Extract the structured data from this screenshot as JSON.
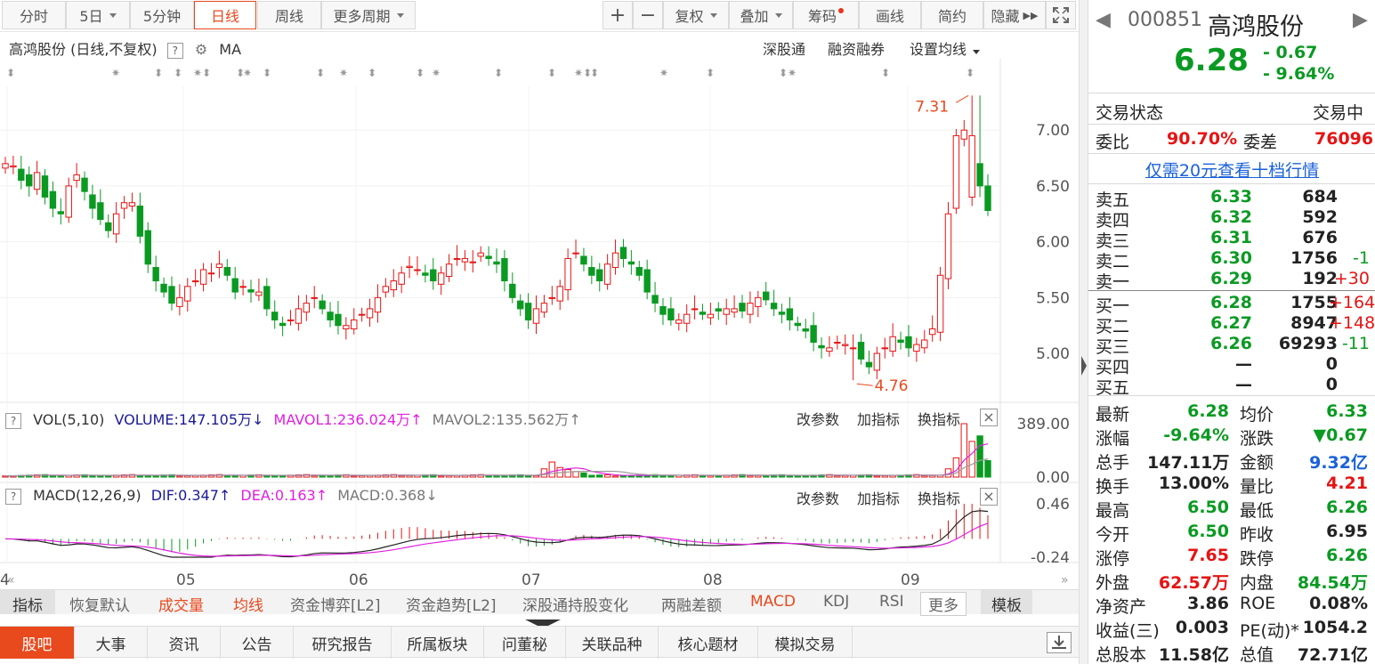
{
  "toolbar": {
    "periods": [
      "分时",
      "5日",
      "5分钟",
      "日线",
      "周线",
      "更多周期"
    ],
    "tools": [
      "复权",
      "叠加",
      "筹码",
      "画线",
      "简约",
      "隐藏"
    ],
    "plus": "+",
    "minus": "−"
  },
  "main_header": {
    "title": "高鸿股份 (日线,不复权)",
    "help": "?",
    "indicator": "MA",
    "links": [
      "深股通",
      "融资融券",
      "设置均线"
    ]
  },
  "vol_header": {
    "help": "?",
    "name": "VOL(5,10)",
    "volume": "VOLUME:147.105万",
    "mavol1": "MAVOL1:236.024万",
    "mavol2": "MAVOL2:135.562万",
    "actions": [
      "改参数",
      "加指标",
      "换指标"
    ],
    "close": "×"
  },
  "macd_header": {
    "help": "?",
    "name": "MACD(12,26,9)",
    "dif": "DIF:0.347",
    "dea": "DEA:0.163",
    "macd": "MACD:0.368",
    "actions": [
      "改参数",
      "加指标",
      "换指标"
    ],
    "close": "×"
  },
  "colors": {
    "up": "#e61414",
    "down": "#0a9a22",
    "accent": "#e8491d",
    "ma_dif": "#222222",
    "dea": "#e020e0"
  },
  "chart_data": [
    {
      "type": "candlestick",
      "title": "高鸿股份 (日线,不复权)",
      "x_ticks": [
        "4",
        "05",
        "06",
        "07",
        "08",
        "09"
      ],
      "y_ticks": [
        7.0,
        6.5,
        6.0,
        5.5,
        5.0
      ],
      "ylim": [
        4.65,
        7.4
      ],
      "annotations": [
        {
          "label": "7.31",
          "value": 7.31
        },
        {
          "label": "4.76",
          "value": 4.76
        }
      ],
      "closes": [
        6.7,
        6.68,
        6.55,
        6.5,
        6.62,
        6.4,
        6.3,
        6.25,
        6.5,
        6.6,
        6.45,
        6.3,
        6.2,
        6.1,
        6.25,
        6.35,
        6.35,
        6.05,
        5.8,
        5.65,
        5.55,
        5.45,
        5.5,
        5.6,
        5.65,
        5.75,
        5.72,
        5.8,
        5.7,
        5.55,
        5.6,
        5.55,
        5.55,
        5.4,
        5.3,
        5.25,
        5.3,
        5.4,
        5.45,
        5.5,
        5.4,
        5.3,
        5.25,
        5.25,
        5.3,
        5.35,
        5.4,
        5.5,
        5.6,
        5.65,
        5.72,
        5.78,
        5.75,
        5.7,
        5.65,
        5.72,
        5.8,
        5.85,
        5.85,
        5.82,
        5.9,
        5.85,
        5.8,
        5.65,
        5.5,
        5.4,
        5.3,
        5.4,
        5.45,
        5.5,
        5.6,
        5.85,
        5.9,
        5.8,
        5.7,
        5.65,
        5.8,
        5.9,
        5.85,
        5.8,
        5.7,
        5.55,
        5.45,
        5.35,
        5.3,
        5.3,
        5.35,
        5.4,
        5.35,
        5.35,
        5.38,
        5.4,
        5.4,
        5.38,
        5.45,
        5.5,
        5.48,
        5.4,
        5.35,
        5.3,
        5.25,
        5.2,
        5.1,
        5.05,
        5.05,
        5.1,
        5.08,
        5.05,
        4.95,
        4.88,
        5.0,
        5.05,
        5.15,
        5.1,
        5.05,
        5.08,
        5.12,
        5.22,
        5.7,
        6.25,
        6.95,
        7.0,
        6.95,
        6.5,
        6.28
      ],
      "volume_ylim": [
        0,
        389.0
      ],
      "volume_ticks": [
        389.0,
        0.0
      ],
      "macd_ylim": [
        -0.24,
        0.46
      ],
      "macd_ticks": [
        0.46,
        -0.24
      ]
    }
  ],
  "bottom": {
    "indicator_tabs": [
      "指标",
      "恢复默认",
      "成交量",
      "均线",
      "资金博弈[L2]",
      "资金趋势[L2]",
      "深股通持股变化",
      "两融差额",
      "MACD",
      "KDJ",
      "RSI",
      "更多",
      "模板"
    ],
    "tabs": [
      "股吧",
      "大事",
      "资讯",
      "公告",
      "研究报告",
      "所属板块",
      "问董秘",
      "关联品种",
      "核心题材",
      "模拟交易"
    ]
  },
  "stock": {
    "code": "000851",
    "name": "高鸿股份",
    "price": "6.28",
    "change": "- 0.67",
    "change_pct": "- 9.64%"
  },
  "trade_status": {
    "label": "交易状态",
    "value": "交易中",
    "ratio_label": "委比",
    "ratio": "90.70%",
    "diff_label": "委差",
    "diff": "76096",
    "promo": "仅需20元查看十档行情"
  },
  "asks": [
    {
      "label": "卖五",
      "price": "6.33",
      "vol": "684",
      "chg": ""
    },
    {
      "label": "卖四",
      "price": "6.32",
      "vol": "592",
      "chg": ""
    },
    {
      "label": "卖三",
      "price": "6.31",
      "vol": "676",
      "chg": ""
    },
    {
      "label": "卖二",
      "price": "6.30",
      "vol": "1756",
      "chg": "-1"
    },
    {
      "label": "卖一",
      "price": "6.29",
      "vol": "192",
      "chg": "+30"
    }
  ],
  "bids": [
    {
      "label": "买一",
      "price": "6.28",
      "vol": "1755",
      "chg": "+164"
    },
    {
      "label": "买二",
      "price": "6.27",
      "vol": "8947",
      "chg": "+148"
    },
    {
      "label": "买三",
      "price": "6.26",
      "vol": "69293",
      "chg": "-11"
    },
    {
      "label": "买四",
      "price": "—",
      "vol": "0",
      "chg": ""
    },
    {
      "label": "买五",
      "price": "—",
      "vol": "0",
      "chg": ""
    }
  ],
  "stats": [
    {
      "l1": "最新",
      "v1": "6.28",
      "c1": "dn",
      "l2": "均价",
      "v2": "6.33",
      "c2": "dn"
    },
    {
      "l1": "涨幅",
      "v1": "-9.64%",
      "c1": "dn",
      "l2": "涨跌",
      "v2": "▼0.67",
      "c2": "dn"
    },
    {
      "l1": "总手",
      "v1": "147.11万",
      "c1": "blk",
      "l2": "金额",
      "v2": "9.32亿",
      "c2": "blu"
    },
    {
      "l1": "换手",
      "v1": "13.00%",
      "c1": "blk",
      "l2": "量比",
      "v2": "4.21",
      "c2": "up"
    },
    {
      "l1": "最高",
      "v1": "6.50",
      "c1": "dn",
      "l2": "最低",
      "v2": "6.26",
      "c2": "dn"
    },
    {
      "l1": "今开",
      "v1": "6.50",
      "c1": "dn",
      "l2": "昨收",
      "v2": "6.95",
      "c2": "blk"
    },
    {
      "l1": "涨停",
      "v1": "7.65",
      "c1": "up",
      "l2": "跌停",
      "v2": "6.26",
      "c2": "dn"
    },
    {
      "l1": "外盘",
      "v1": "62.57万",
      "c1": "up",
      "l2": "内盘",
      "v2": "84.54万",
      "c2": "dn"
    },
    {
      "l1": "净资产",
      "v1": "3.86",
      "c1": "blk",
      "l2": "ROE",
      "v2": "0.08%",
      "c2": "blk"
    },
    {
      "l1": "收益(三)",
      "v1": "0.003",
      "c1": "blk",
      "l2": "PE(动)*",
      "v2": "1054.2",
      "c2": "blk"
    },
    {
      "l1": "总股本",
      "v1": "11.58亿",
      "c1": "blk",
      "l2": "总值",
      "v2": "72.71亿",
      "c2": "blk"
    }
  ]
}
